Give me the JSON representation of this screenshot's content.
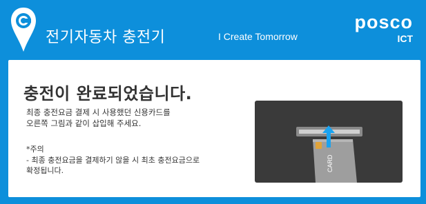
{
  "header": {
    "app_title": "전기자동차 충전기",
    "tagline": "I Create Tomorrow",
    "brand_name": "posco",
    "brand_sub": "ICT",
    "logo_icon": "charging-pin-logo-icon"
  },
  "panel": {
    "heading": "충전이 완료되었습니다.",
    "instruction_line1": "최종 충전요금 결제 시 사용했던 신용카드를",
    "instruction_line2": "오른쪽 그림과 같이 삽입해 주세요.",
    "notice_title": "*주의",
    "notice_line1": "- 최종 충전요금을 결제하기 않을 시 최초 충전요금으로",
    "notice_line2": "확정됩니다.",
    "illustration": {
      "icon": "card-insert-icon",
      "card_label": "CARD"
    }
  },
  "colors": {
    "background": "#0d8fdb",
    "panel": "#ffffff",
    "terminal": "#3a3a3a",
    "arrow": "#1aa3f0",
    "card_chip": "#e0a33a"
  }
}
